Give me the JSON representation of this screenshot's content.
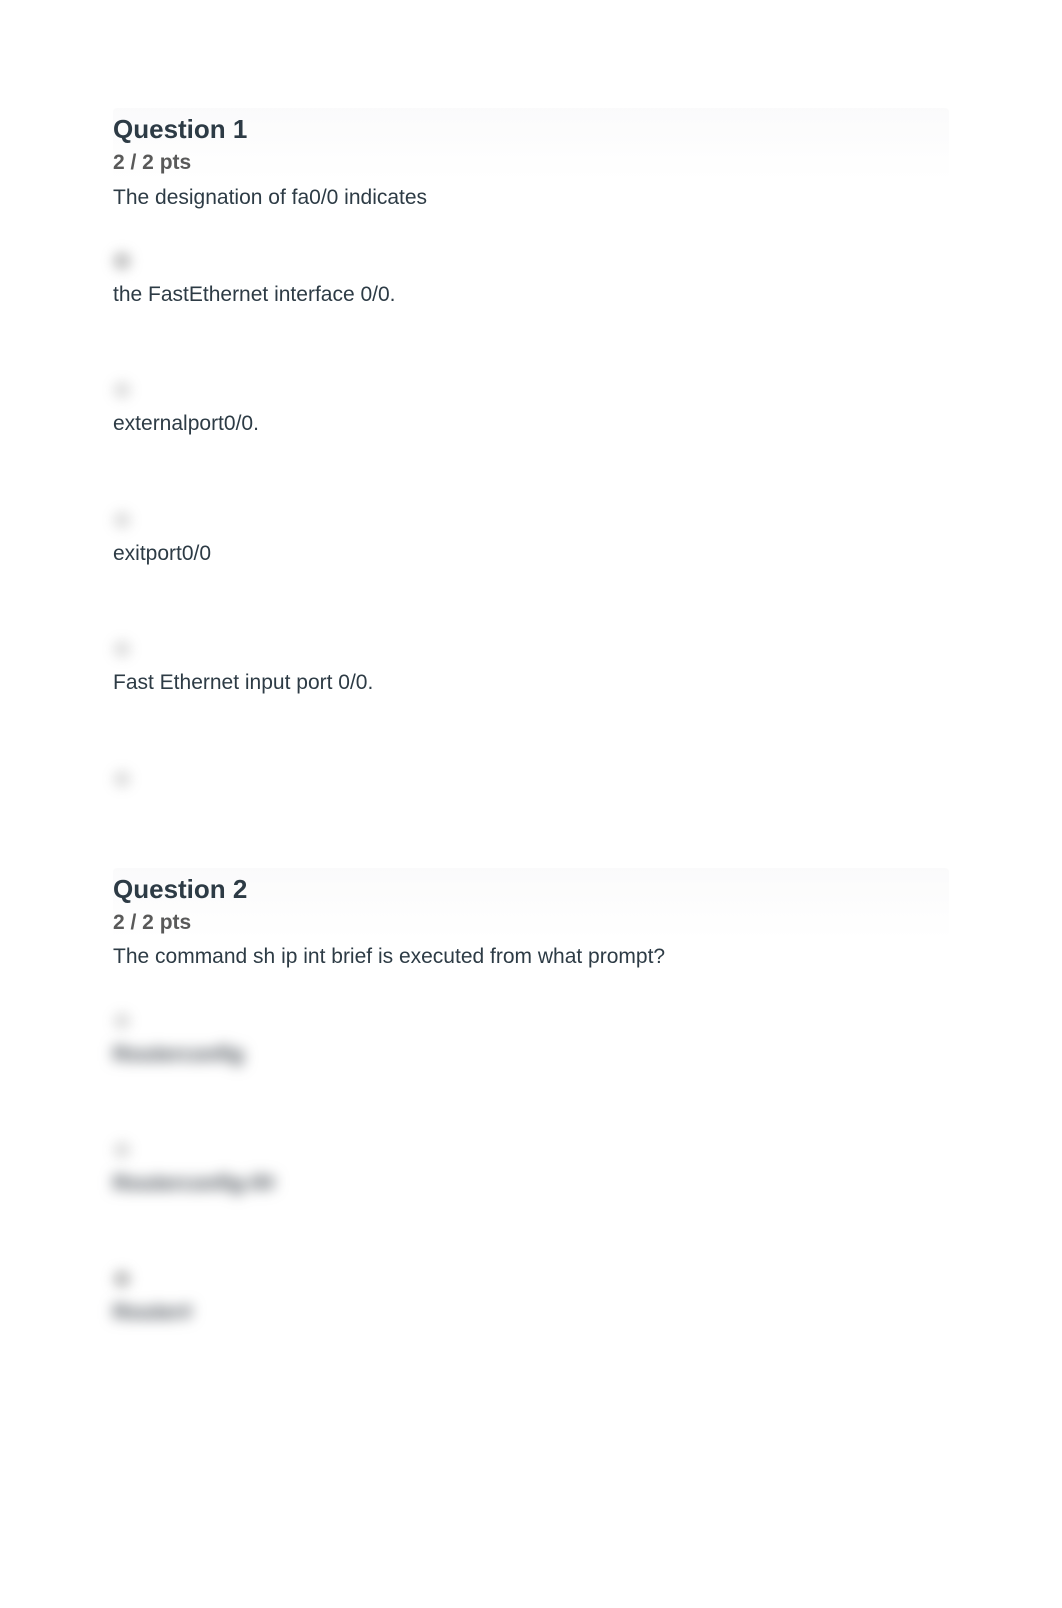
{
  "questions": [
    {
      "title": "Question 1",
      "points": "2 / 2 pts",
      "prompt": "The designation of fa0/0 indicates",
      "answers": [
        {
          "text": "the FastEthernet interface 0/0.",
          "blurred": false,
          "radioOpacity": "dark"
        },
        {
          "text": "externalport0/0.",
          "blurred": false,
          "radioOpacity": "light"
        },
        {
          "text": "exitport0/0",
          "blurred": false,
          "radioOpacity": "light"
        },
        {
          "text": "Fast Ethernet input port 0/0.",
          "blurred": false,
          "radioOpacity": "light"
        },
        {
          "text": "",
          "blurred": false,
          "radioOpacity": "light"
        }
      ]
    },
    {
      "title": "Question 2",
      "points": "2 / 2 pts",
      "prompt": "The command sh ip int brief is executed from what prompt?",
      "answers": [
        {
          "text": "Routerconfig",
          "blurred": true,
          "radioOpacity": "light"
        },
        {
          "text": "Routerconfig-if#",
          "blurred": true,
          "radioOpacity": "light"
        },
        {
          "text": "Router#",
          "blurred": true,
          "radioOpacity": "dark"
        }
      ]
    }
  ]
}
